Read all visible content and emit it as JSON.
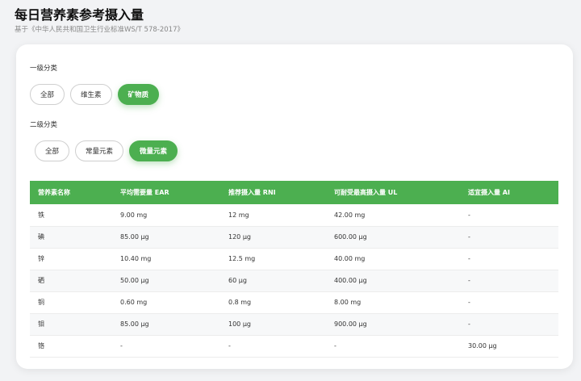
{
  "header": {
    "title": "每日营养素参考摄入量",
    "subtitle": "基于《中华人民共和国卫生行业标准WS/T 578-2017》"
  },
  "filters": {
    "level1": {
      "label": "一级分类",
      "options": [
        "全部",
        "维生素",
        "矿物质"
      ],
      "selected": "矿物质"
    },
    "level2": {
      "label": "二级分类",
      "options": [
        "全部",
        "常量元素",
        "微量元素"
      ],
      "selected": "微量元素"
    }
  },
  "table": {
    "columns": [
      "营养素名称",
      "平均需要量 EAR",
      "推荐摄入量 RNI",
      "可耐受最高摄入量 UL",
      "适宜摄入量 AI"
    ],
    "rows": [
      [
        "铁",
        "9.00 mg",
        "12 mg",
        "42.00 mg",
        "-"
      ],
      [
        "碘",
        "85.00 μg",
        "120 μg",
        "600.00 μg",
        "-"
      ],
      [
        "锌",
        "10.40 mg",
        "12.5 mg",
        "40.00 mg",
        "-"
      ],
      [
        "硒",
        "50.00 μg",
        "60 μg",
        "400.00 μg",
        "-"
      ],
      [
        "铜",
        "0.60 mg",
        "0.8 mg",
        "8.00 mg",
        "-"
      ],
      [
        "钼",
        "85.00 μg",
        "100 μg",
        "900.00 μg",
        "-"
      ],
      [
        "铬",
        "-",
        "-",
        "-",
        "30.00 μg"
      ]
    ]
  },
  "colors": {
    "accent": "#4caf50",
    "background": "#f2f3f5",
    "card": "#ffffff"
  }
}
